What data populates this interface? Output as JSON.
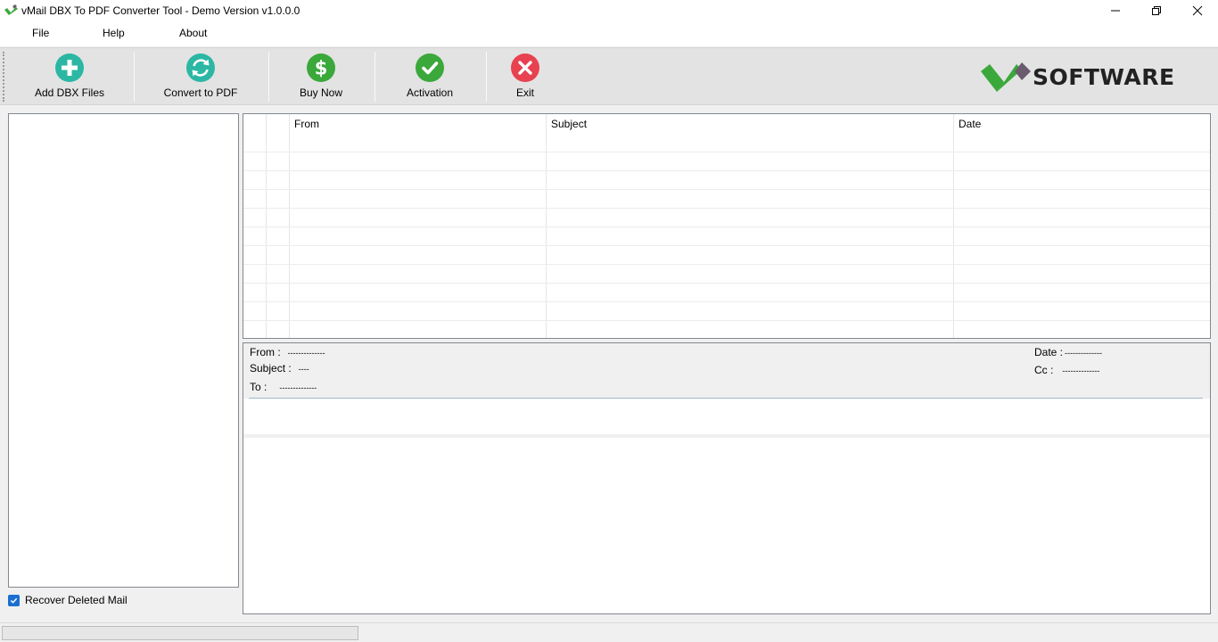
{
  "window": {
    "title": "vMail DBX To PDF Converter Tool - Demo Version v1.0.0.0"
  },
  "menu": {
    "items": [
      {
        "label": "File"
      },
      {
        "label": "Help"
      },
      {
        "label": "About"
      }
    ]
  },
  "toolbar": {
    "add_label": "Add DBX Files",
    "convert_label": "Convert to PDF",
    "buy_label": "Buy Now",
    "activation_label": "Activation",
    "exit_label": "Exit",
    "colors": {
      "add": "#2bb7a3",
      "convert": "#2bb7a3",
      "buy": "#3aa83a",
      "activation": "#3aa83a",
      "exit": "#e8414f"
    }
  },
  "logo": {
    "text": "SOFTWARE",
    "colors": [
      "#3aa83a",
      "#6b5b6e"
    ]
  },
  "left_panel": {
    "recover_label": "Recover Deleted Mail",
    "recover_checked": true
  },
  "grid": {
    "columns": [
      "From",
      "Subject",
      "Date"
    ]
  },
  "preview": {
    "from_label": "From :",
    "from_value": "--------------",
    "subject_label": "Subject :",
    "subject_value": "----",
    "to_label": "To :",
    "to_value": "--------------",
    "date_label": "Date :",
    "date_value": "--------------",
    "cc_label": "Cc :",
    "cc_value": "--------------"
  },
  "status": {
    "progress": 0
  }
}
